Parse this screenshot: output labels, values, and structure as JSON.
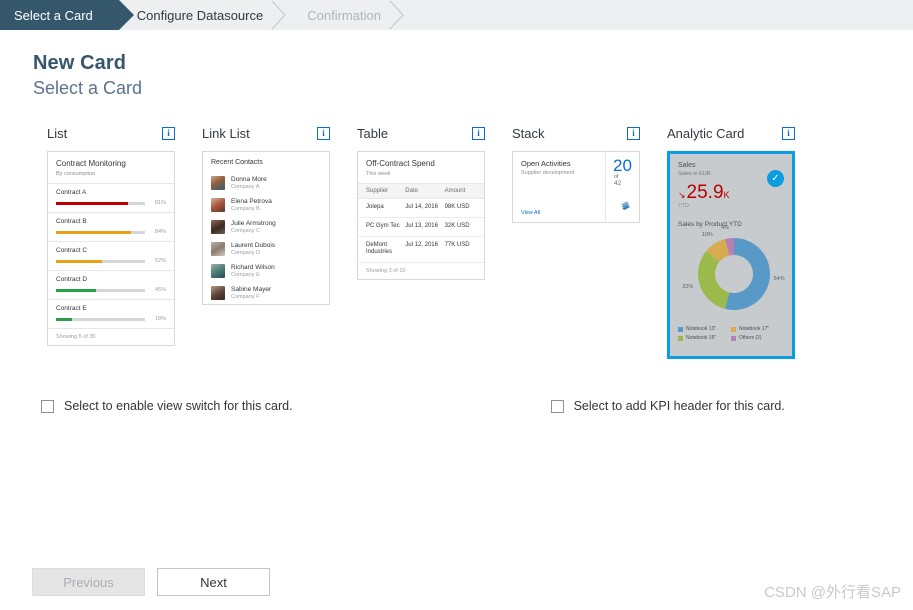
{
  "steps": [
    {
      "label": "Select a Card",
      "state": "active"
    },
    {
      "label": "Configure Datasource",
      "state": "enabled"
    },
    {
      "label": "Confirmation",
      "state": "disabled"
    }
  ],
  "page": {
    "title": "New Card",
    "subtitle": "Select a Card"
  },
  "cards": [
    {
      "title": "List",
      "info": "i"
    },
    {
      "title": "Link List",
      "info": "i"
    },
    {
      "title": "Table",
      "info": "i"
    },
    {
      "title": "Stack",
      "info": "i"
    },
    {
      "title": "Analytic Card",
      "info": "i"
    }
  ],
  "list_card": {
    "header": "Contract Monitoring",
    "subheader": "By consumption",
    "rows": [
      {
        "name": "Contract A",
        "pct": "81%",
        "value": 81,
        "color": "#bb0000"
      },
      {
        "name": "Contract B",
        "pct": "84%",
        "value": 84,
        "color": "#e9a117"
      },
      {
        "name": "Contract C",
        "pct": "52%",
        "value": 52,
        "color": "#e9a117"
      },
      {
        "name": "Contract D",
        "pct": "45%",
        "value": 45,
        "color": "#2b9e48"
      },
      {
        "name": "Contract E",
        "pct": "18%",
        "value": 18,
        "color": "#2b9e48"
      }
    ],
    "footer": "Showing 5 of 35"
  },
  "link_card": {
    "header": "Recent Contacts",
    "rows": [
      {
        "name": "Donna More",
        "company": "Company A"
      },
      {
        "name": "Elena Petrova",
        "company": "Company B"
      },
      {
        "name": "Julie Armstrong",
        "company": "Company C"
      },
      {
        "name": "Laurent Dubois",
        "company": "Company D"
      },
      {
        "name": "Richard Wilson",
        "company": "Company E"
      },
      {
        "name": "Sabine Mayer",
        "company": "Company F"
      }
    ]
  },
  "table_card": {
    "header": "Off-Contract Spend",
    "subheader": "This week",
    "columns": [
      "Supplier",
      "Date",
      "Amount"
    ],
    "rows": [
      {
        "supplier": "Jolepa",
        "date": "Jul 14, 2016",
        "amount": "98K USD"
      },
      {
        "supplier": "PC Gym Tec",
        "date": "Jul 13, 2016",
        "amount": "32K USD"
      },
      {
        "supplier": "DeMont Industries",
        "date": "Jul 12, 2016",
        "amount": "77K USD"
      }
    ],
    "footer": "Showing 3 of 10"
  },
  "stack_card": {
    "header": "Open Activities",
    "subheader": "Supplier development",
    "number": "20",
    "of_label": "of",
    "total": "42",
    "link": "View All"
  },
  "analytic_card": {
    "header": "Sales",
    "subheader": "Sales in EUR",
    "trend_arrow": "↘",
    "value": "25.9",
    "unit": "K",
    "period": "YTD",
    "check": "✓",
    "chart_title": "Sales by Product YTD",
    "border_color": "#0a9de0",
    "check_color": "#0a9de0",
    "value_color": "#bb0000"
  },
  "chart_data": {
    "type": "pie",
    "title": "Sales by Product YTD",
    "labels": [
      "Notebook 13\"",
      "Notebook 15\"",
      "Notebook 17\"",
      "Others (2)"
    ],
    "values": [
      54,
      32,
      10,
      4
    ],
    "tick_labels": [
      "54%",
      "32%",
      "10%",
      "4%"
    ],
    "colors": [
      "#5899c8",
      "#9cba4b",
      "#d7ac51",
      "#b77fb4"
    ],
    "donut": true,
    "legend": "bottom"
  },
  "checkboxes": [
    {
      "label": "Select to enable view switch for this card.",
      "checked": false
    },
    {
      "label": "Select to add KPI header for this card.",
      "checked": false
    }
  ],
  "footer": {
    "previous": "Previous",
    "next": "Next",
    "watermark": "CSDN @外行看SAP"
  }
}
